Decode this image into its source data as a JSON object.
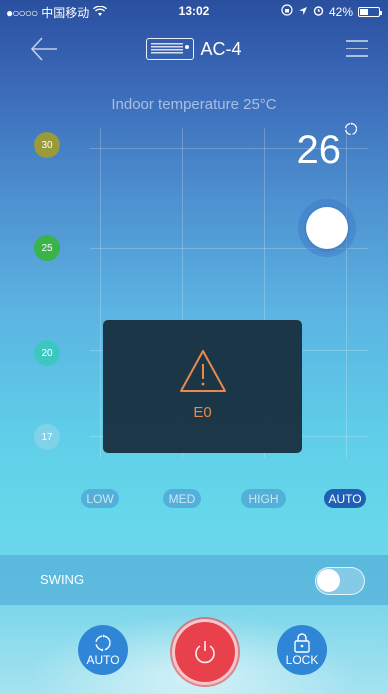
{
  "status_bar": {
    "carrier": "中国移动",
    "time": "13:02",
    "battery": "42%",
    "battery_level": 0.42
  },
  "header": {
    "title": "AC-4"
  },
  "indoor": {
    "text": "Indoor temperature 25°C"
  },
  "set_temperature": "26",
  "temperature_scale": [
    {
      "label": "30",
      "color": "#9a9a3a"
    },
    {
      "label": "25",
      "color": "#39b34a"
    },
    {
      "label": "20",
      "color": "#3cc8c0"
    },
    {
      "label": "17",
      "color": "#7fd2e8"
    }
  ],
  "error": {
    "code": "E0",
    "color": "#e98a4a"
  },
  "fan_speeds": [
    {
      "label": "LOW",
      "active": false
    },
    {
      "label": "MED",
      "active": false
    },
    {
      "label": "HIGH",
      "active": false
    },
    {
      "label": "AUTO",
      "active": true
    }
  ],
  "swing": {
    "label": "SWING",
    "on": false
  },
  "bottom": {
    "mode_label": "AUTO",
    "lock_label": "LOCK"
  }
}
